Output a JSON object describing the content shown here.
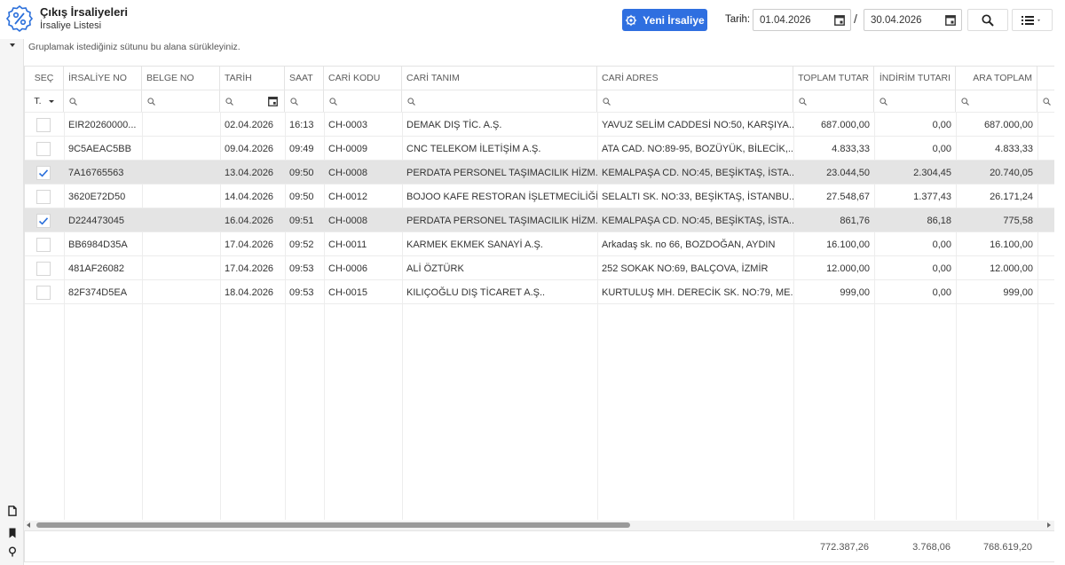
{
  "header": {
    "title": "Çıkış İrsaliyeleri",
    "subtitle": "İrsaliye Listesi",
    "new_button_label": "Yeni İrsaliye",
    "date_label": "Tarih:",
    "date_from": "01.04.2026",
    "date_separator": "/",
    "date_to": "30.04.2026"
  },
  "group_panel_text": "Gruplamak istediğiniz sütunu bu alana sürükleyiniz.",
  "columns": [
    "SEÇ",
    "İRSALİYE NO",
    "BELGE NO",
    "TARİH",
    "SAAT",
    "CARİ KODU",
    "CARİ TANIM",
    "CARİ ADRES",
    "TOPLAM TUTAR",
    "İNDİRİM TUTARI",
    "ARA TOPLAM"
  ],
  "select_filter_value": "T.",
  "rows": [
    {
      "selected": false,
      "irsaliye_no": "EIR20260000...",
      "belge_no": "",
      "tarih": "02.04.2026",
      "saat": "16:13",
      "cari_kodu": "CH-0003",
      "cari_tanim": "DEMAK DIŞ TİC. A.Ş.",
      "cari_adres": "YAVUZ SELİM CADDESİ NO:50, KARŞIYA...",
      "toplam": "687.000,00",
      "indirim": "0,00",
      "ara_toplam": "687.000,00"
    },
    {
      "selected": false,
      "irsaliye_no": "9C5AEAC5BB",
      "belge_no": "",
      "tarih": "09.04.2026",
      "saat": "09:49",
      "cari_kodu": "CH-0009",
      "cari_tanim": "CNC TELEKOM İLETİŞİM A.Ş.",
      "cari_adres": "ATA CAD. NO:89-95, BOZÜYÜK, BİLECİK,...",
      "toplam": "4.833,33",
      "indirim": "0,00",
      "ara_toplam": "4.833,33"
    },
    {
      "selected": true,
      "irsaliye_no": "7A16765563",
      "belge_no": "",
      "tarih": "13.04.2026",
      "saat": "09:50",
      "cari_kodu": "CH-0008",
      "cari_tanim": "PERDATA PERSONEL TAŞIMACILIK HİZM...",
      "cari_adres": "KEMALPAŞA CD. NO:45, BEŞİKTAŞ, İSTA...",
      "toplam": "23.044,50",
      "indirim": "2.304,45",
      "ara_toplam": "20.740,05"
    },
    {
      "selected": false,
      "irsaliye_no": "3620E72D50",
      "belge_no": "",
      "tarih": "14.04.2026",
      "saat": "09:50",
      "cari_kodu": "CH-0012",
      "cari_tanim": "BOJOO KAFE RESTORAN İŞLETMECİLİĞİ ...",
      "cari_adres": "SELALTI SK. NO:33, BEŞİKTAŞ, İSTANBU...",
      "toplam": "27.548,67",
      "indirim": "1.377,43",
      "ara_toplam": "26.171,24"
    },
    {
      "selected": true,
      "irsaliye_no": "D224473045",
      "belge_no": "",
      "tarih": "16.04.2026",
      "saat": "09:51",
      "cari_kodu": "CH-0008",
      "cari_tanim": "PERDATA PERSONEL TAŞIMACILIK HİZM...",
      "cari_adres": "KEMALPAŞA CD. NO:45, BEŞİKTAŞ, İSTA...",
      "toplam": "861,76",
      "indirim": "86,18",
      "ara_toplam": "775,58"
    },
    {
      "selected": false,
      "irsaliye_no": "BB6984D35A",
      "belge_no": "",
      "tarih": "17.04.2026",
      "saat": "09:52",
      "cari_kodu": "CH-0011",
      "cari_tanim": "KARMEK EKMEK SANAYİ A.Ş.",
      "cari_adres": "Arkadaş sk. no 66, BOZDOĞAN, AYDIN",
      "toplam": "16.100,00",
      "indirim": "0,00",
      "ara_toplam": "16.100,00"
    },
    {
      "selected": false,
      "irsaliye_no": "481AF26082",
      "belge_no": "",
      "tarih": "17.04.2026",
      "saat": "09:53",
      "cari_kodu": "CH-0006",
      "cari_tanim": "ALİ ÖZTÜRK",
      "cari_adres": "252 SOKAK NO:69, BALÇOVA, İZMİR",
      "toplam": "12.000,00",
      "indirim": "0,00",
      "ara_toplam": "12.000,00"
    },
    {
      "selected": false,
      "irsaliye_no": "82F374D5EA",
      "belge_no": "",
      "tarih": "18.04.2026",
      "saat": "09:53",
      "cari_kodu": "CH-0015",
      "cari_tanim": "KILIÇOĞLU DIŞ TİCARET A.Ş..",
      "cari_adres": "KURTULUŞ MH. DERECİK SK. NO:79, ME...",
      "toplam": "999,00",
      "indirim": "0,00",
      "ara_toplam": "999,00"
    }
  ],
  "totals": {
    "toplam": "772.387,26",
    "indirim": "3.768,06",
    "ara_toplam": "768.619,20"
  },
  "colors": {
    "accent": "#2f6fe0",
    "selected_row": "#e4e4e4",
    "check": "#2a6fdb"
  },
  "icons": [
    "percent-badge-icon",
    "gear-icon",
    "calendar-icon",
    "search-icon",
    "list-icon",
    "chevron-down-icon",
    "document-icon",
    "bookmark-icon",
    "lightbulb-icon",
    "check-icon"
  ]
}
